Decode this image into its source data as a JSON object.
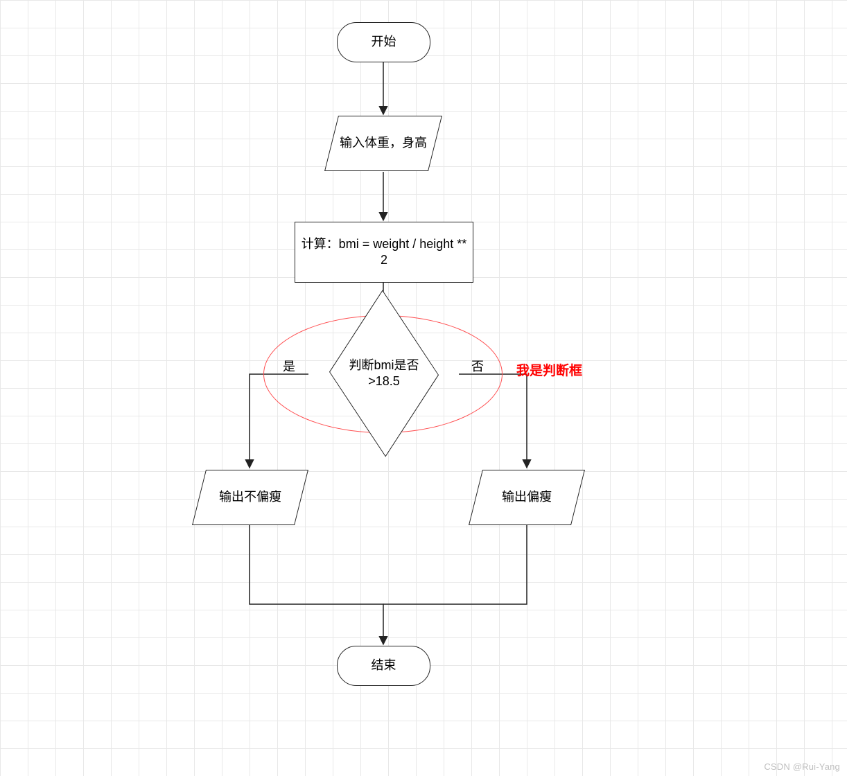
{
  "meta": {
    "watermark": "CSDN @Rui-Yang"
  },
  "nodes": {
    "start": "开始",
    "input": "输入体重，身高",
    "compute": "计算：bmi = weight / height ** 2",
    "decision": "判断bmi是否 >18.5",
    "out_yes": "输出不偏瘦",
    "out_no": "输出偏瘦",
    "end": "结束"
  },
  "labels": {
    "yes": "是",
    "no": "否"
  },
  "annotation": "我是判断框"
}
